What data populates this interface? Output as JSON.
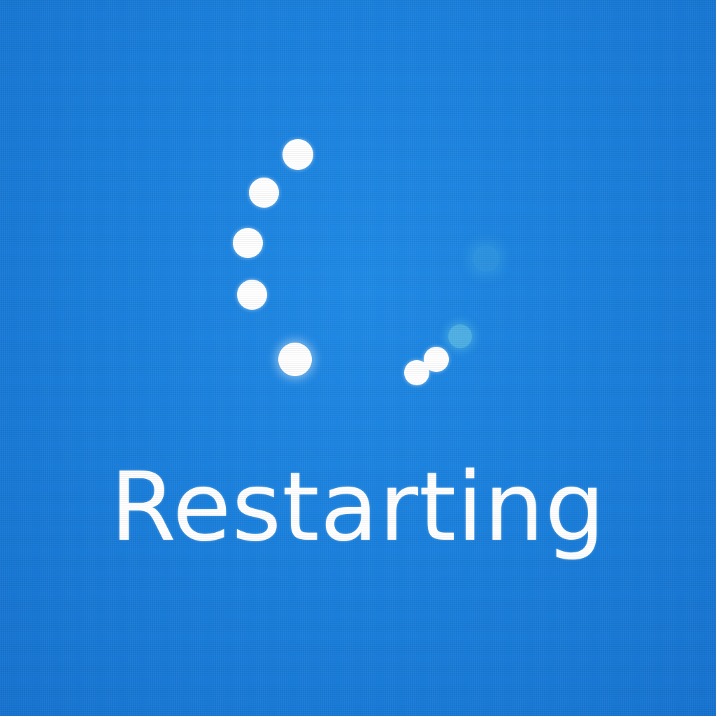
{
  "screen": {
    "status_text": "Restarting",
    "background_color": "#1a80dd",
    "foreground_color": "#ffffff"
  },
  "spinner": {
    "icon": "loading-spinner-icon",
    "dot_count": 9
  }
}
